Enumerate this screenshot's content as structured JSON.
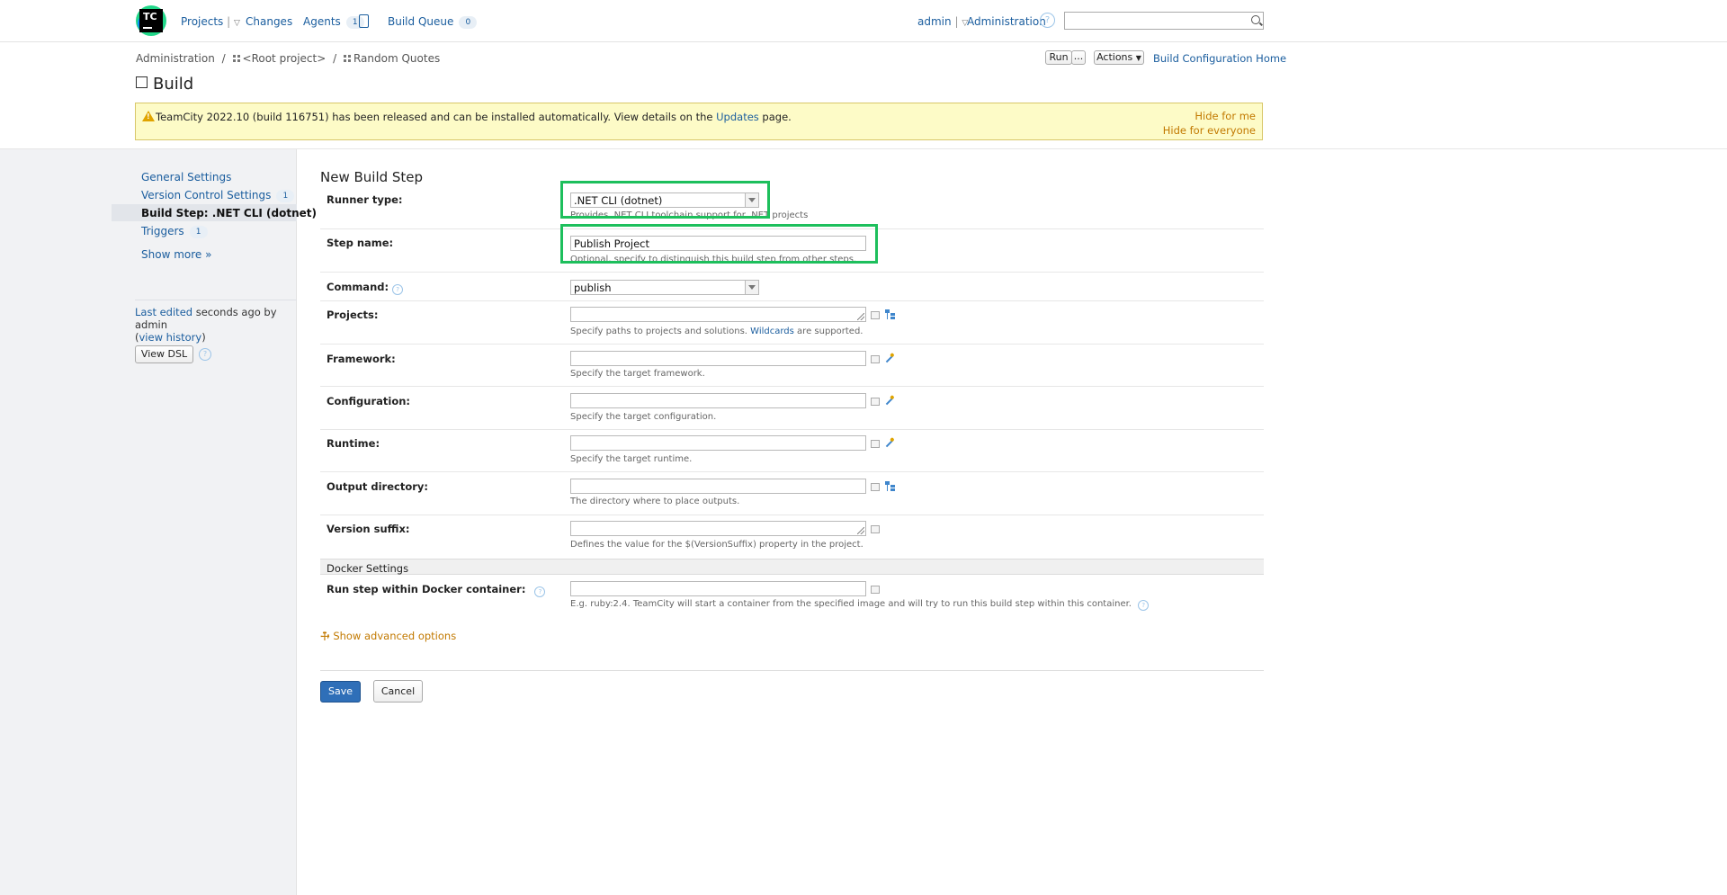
{
  "header": {
    "logo_text": "TC",
    "nav": {
      "projects": "Projects",
      "changes": "Changes",
      "agents": "Agents",
      "agents_count": "1",
      "build_queue": "Build Queue",
      "build_queue_count": "0"
    },
    "user": "admin",
    "administration": "Administration",
    "help_glyph": "?",
    "search_value": ""
  },
  "breadcrumb": {
    "items": [
      "Administration",
      "<Root project>",
      "Random Quotes"
    ],
    "separator": "/"
  },
  "toolbar": {
    "run": "Run",
    "run_more": "...",
    "actions": "Actions",
    "home": "Build Configuration Home"
  },
  "page": {
    "title": "Build"
  },
  "banner": {
    "text_before": "TeamCity 2022.10 (build 116751) has been released and can be installed automatically. View details on the ",
    "link": "Updates",
    "text_after": " page.",
    "hide_me": "Hide for me",
    "hide_all": "Hide for everyone"
  },
  "sidebar": {
    "items": [
      {
        "label": "General Settings",
        "count": ""
      },
      {
        "label": "Version Control Settings",
        "count": "1"
      },
      {
        "label": "Build Step: .NET CLI (dotnet)",
        "count": ""
      },
      {
        "label": "Triggers",
        "count": "1"
      },
      {
        "label": "Show more »",
        "count": ""
      }
    ],
    "last_edited_link": "Last edited",
    "last_edited_rest": " seconds ago by admin",
    "view_history": "view history",
    "view_dsl": "View DSL"
  },
  "form": {
    "title": "New Build Step",
    "runner_type": {
      "label": "Runner type:",
      "value": ".NET CLI (dotnet)",
      "note": "Provides .NET CLI toolchain support for .NET projects"
    },
    "step_name": {
      "label": "Step name:",
      "value": "Publish Project",
      "note": "Optional, specify to distinguish this build step from other steps."
    },
    "command": {
      "label": "Command:",
      "value": "publish"
    },
    "projects": {
      "label": "Projects:",
      "value": "",
      "note_before": "Specify paths to projects and solutions. ",
      "note_link": "Wildcards",
      "note_after": " are supported."
    },
    "framework": {
      "label": "Framework:",
      "value": "",
      "note": "Specify the target framework."
    },
    "configuration": {
      "label": "Configuration:",
      "value": "",
      "note": "Specify the target configuration."
    },
    "runtime": {
      "label": "Runtime:",
      "value": "",
      "note": "Specify the target runtime."
    },
    "output_directory": {
      "label": "Output directory:",
      "value": "",
      "note": "The directory where to place outputs."
    },
    "version_suffix": {
      "label": "Version suffix:",
      "value": "",
      "note": "Defines the value for the $(VersionSuffix) property in the project."
    },
    "docker": {
      "section": "Docker Settings",
      "label": "Run step within Docker container:",
      "value": "",
      "note": "E.g. ruby:2.4. TeamCity will start a container from the specified image and will try to run this build step within this container."
    },
    "advanced": "Show advanced options",
    "save": "Save",
    "cancel": "Cancel"
  },
  "colors": {
    "link": "#1a5d9e",
    "highlight": "#1dbf5c",
    "banner_bg": "#fdfbc7",
    "primary_button": "#2f6fb8",
    "sidebar_bg": "#f1f2f4"
  }
}
